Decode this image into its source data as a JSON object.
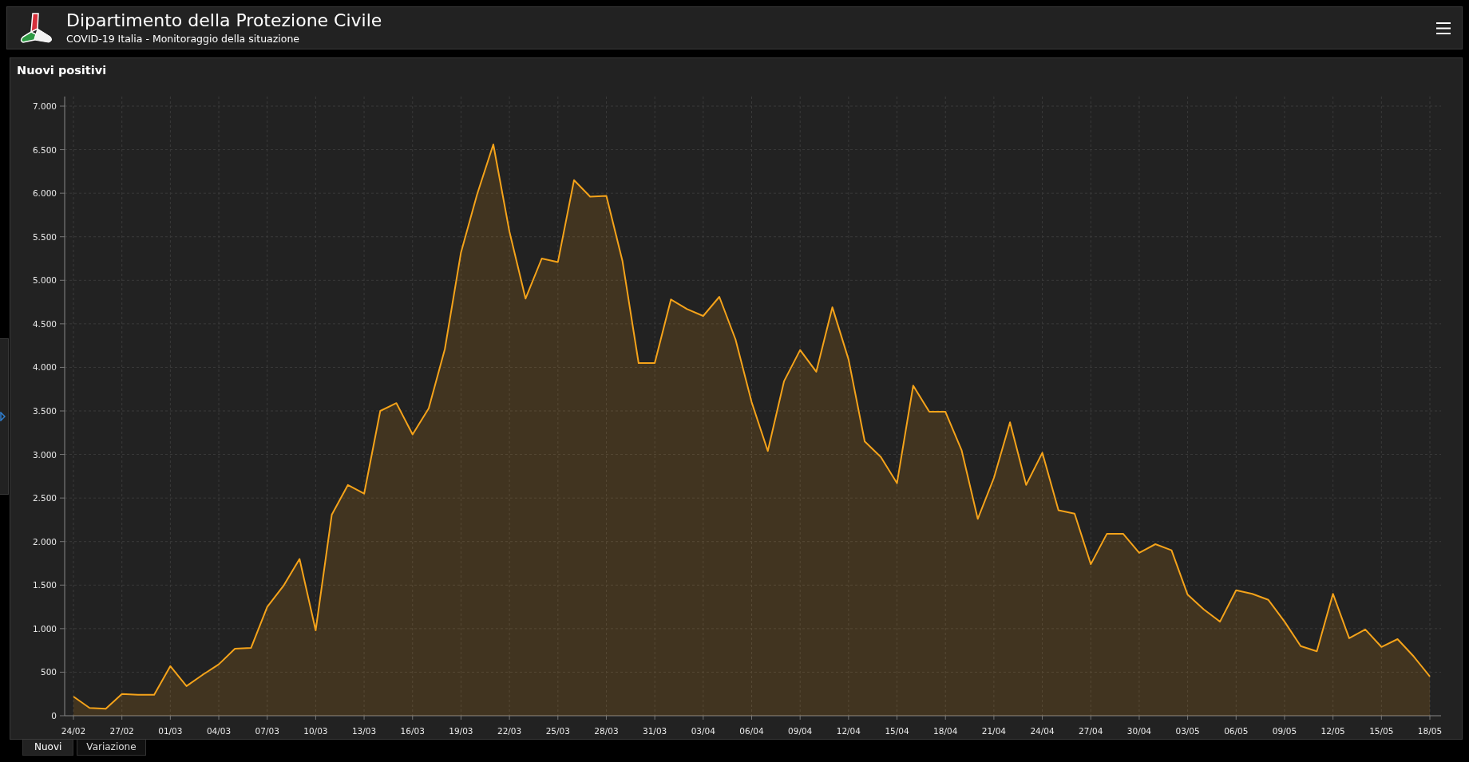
{
  "header": {
    "title": "Dipartimento della Protezione Civile",
    "subtitle": "COVID-19 Italia - Monitoraggio della situazione"
  },
  "panel": {
    "title": "Nuovi positivi",
    "chart_data": {
      "type": "area",
      "grid": true,
      "categories": [
        "24/02",
        null,
        null,
        "27/02",
        null,
        null,
        "01/03",
        null,
        null,
        "04/03",
        null,
        null,
        "07/03",
        null,
        null,
        "10/03",
        null,
        null,
        "13/03",
        null,
        null,
        "16/03",
        null,
        null,
        "19/03",
        null,
        null,
        "22/03",
        null,
        null,
        "25/03",
        null,
        null,
        "28/03",
        null,
        null,
        "31/03",
        null,
        null,
        "03/04",
        null,
        null,
        "06/04",
        null,
        null,
        "09/04",
        null,
        null,
        "12/04",
        null,
        null,
        "15/04",
        null,
        null,
        "18/04",
        null,
        null,
        "21/04",
        null,
        null,
        "24/04",
        null,
        null,
        "27/04",
        null,
        null,
        "30/04",
        null,
        null,
        "03/05",
        null,
        null,
        "06/05",
        null,
        null,
        "09/05",
        null,
        null,
        "12/05",
        null,
        null,
        "15/05",
        null,
        null,
        "18/05"
      ],
      "series": [
        {
          "color": "#f5a31a",
          "values": [
            220,
            90,
            80,
            250,
            240,
            240,
            570,
            340,
            470,
            590,
            770,
            780,
            1250,
            1490,
            1800,
            980,
            2310,
            2650,
            2550,
            3500,
            3590,
            3230,
            3530,
            4210,
            5320,
            5990,
            6560,
            5560,
            4790,
            5250,
            5210,
            6150,
            5960,
            5970,
            5220,
            4050,
            4050,
            4780,
            4670,
            4590,
            4810,
            4320,
            3600,
            3040,
            3840,
            4200,
            3950,
            4690,
            4090,
            3150,
            2970,
            2670,
            3790,
            3490,
            3490,
            3050,
            2260,
            2730,
            3370,
            2650,
            3020,
            2360,
            2320,
            1740,
            2090,
            2090,
            1870,
            1970,
            1900,
            1390,
            1220,
            1080,
            1440,
            1400,
            1330,
            1080,
            800,
            740,
            1400,
            890,
            990,
            790,
            880,
            680,
            450
          ]
        }
      ],
      "ylim": [
        0,
        7000
      ],
      "yticks": [
        {
          "value": 0,
          "label": "0"
        },
        {
          "value": 500,
          "label": "500"
        },
        {
          "value": 1000,
          "label": "1.000"
        },
        {
          "value": 1500,
          "label": "1.500"
        },
        {
          "value": 2000,
          "label": "2.000"
        },
        {
          "value": 2500,
          "label": "2.500"
        },
        {
          "value": 3000,
          "label": "3.000"
        },
        {
          "value": 3500,
          "label": "3.500"
        },
        {
          "value": 4000,
          "label": "4.000"
        },
        {
          "value": 4500,
          "label": "4.500"
        },
        {
          "value": 5000,
          "label": "5.000"
        },
        {
          "value": 5500,
          "label": "5.500"
        },
        {
          "value": 6000,
          "label": "6.000"
        },
        {
          "value": 6500,
          "label": "6.500"
        },
        {
          "value": 7000,
          "label": "7.000"
        }
      ]
    }
  },
  "tabs": [
    {
      "label": "Nuovi",
      "selected": true
    },
    {
      "label": "Variazione",
      "selected": false
    }
  ]
}
